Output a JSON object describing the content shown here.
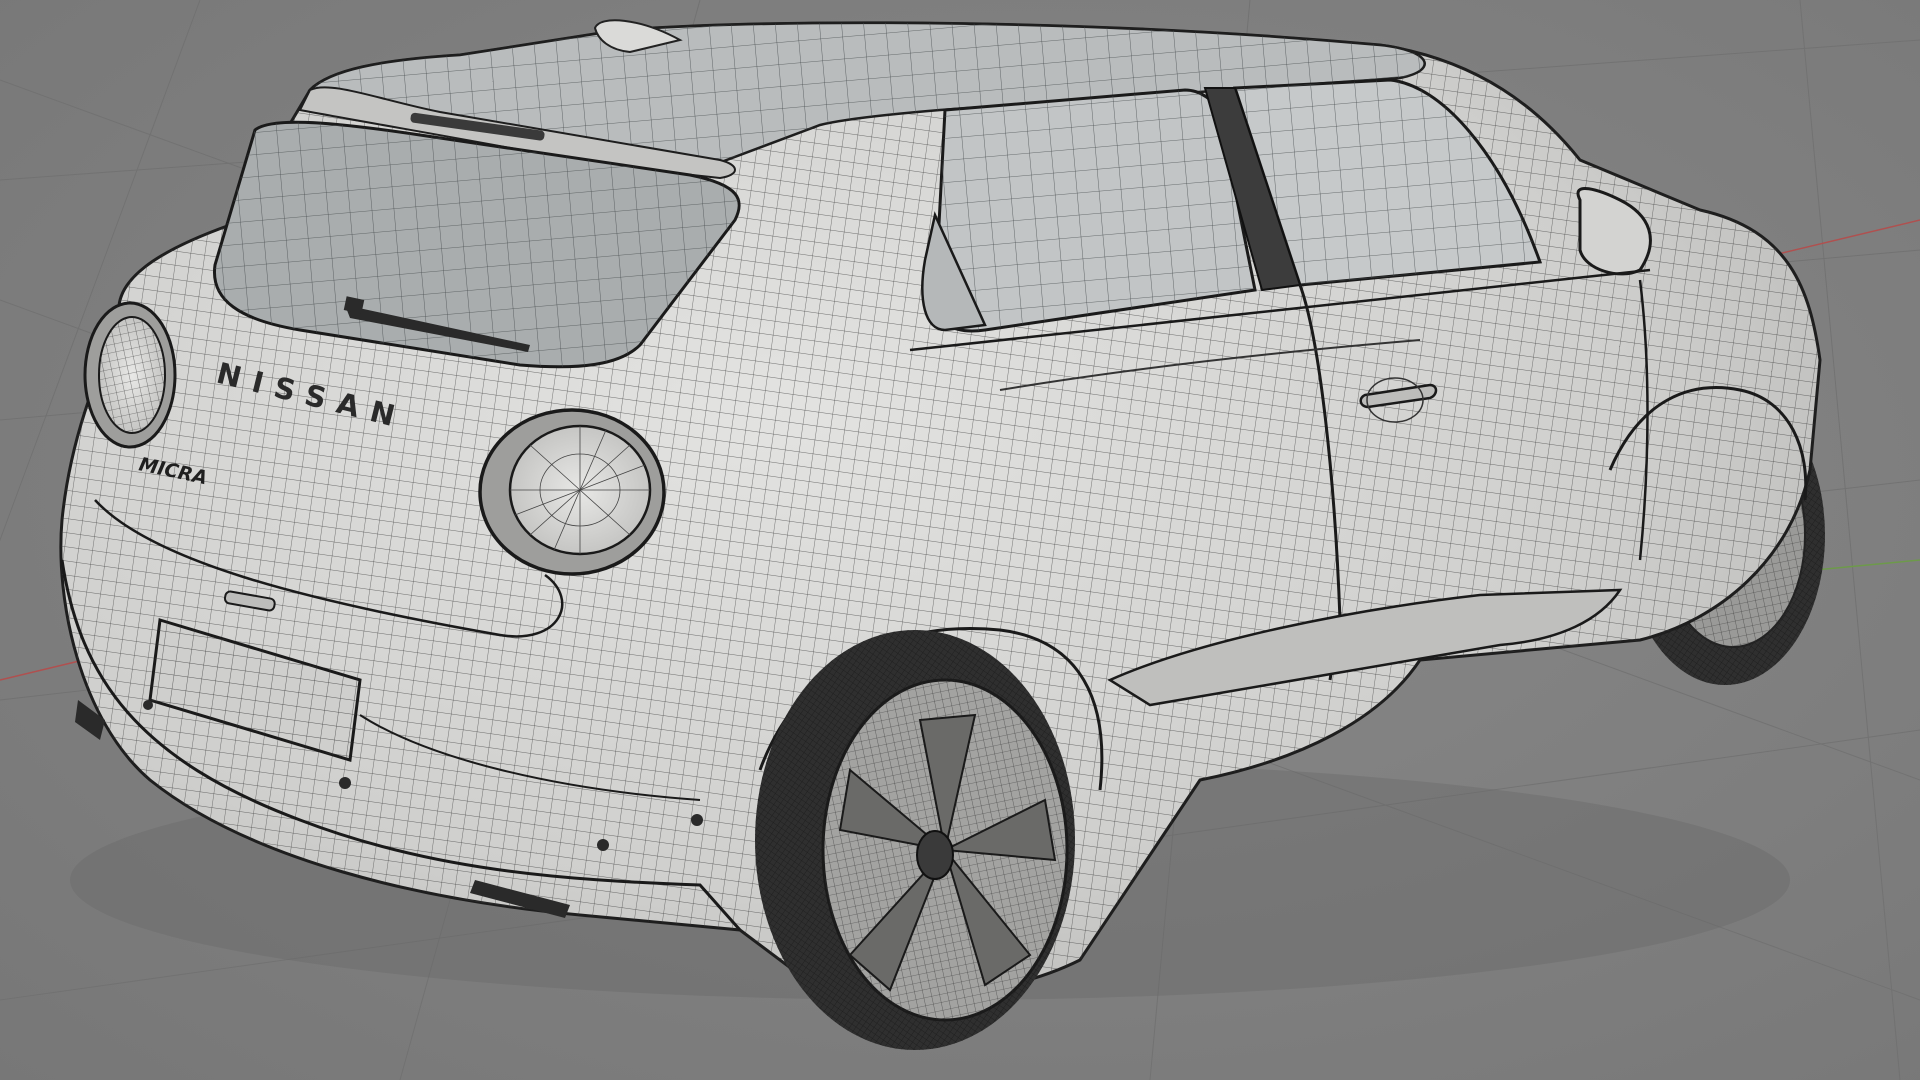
{
  "viewport": {
    "mode": "wireframe-on-shaded",
    "background_color": "#7f7f7f",
    "grid_color": "#6e6e6e",
    "x_axis_color": "#b0504f",
    "y_axis_color": "#6d9a4a"
  },
  "model": {
    "body_color": "#d6d6d4",
    "wire_color": "#2b2b2b",
    "glass_color": "#a9adae",
    "tire_color": "#2f2f2f",
    "brand_badge": "NISSAN",
    "model_badge": "MICRA"
  }
}
